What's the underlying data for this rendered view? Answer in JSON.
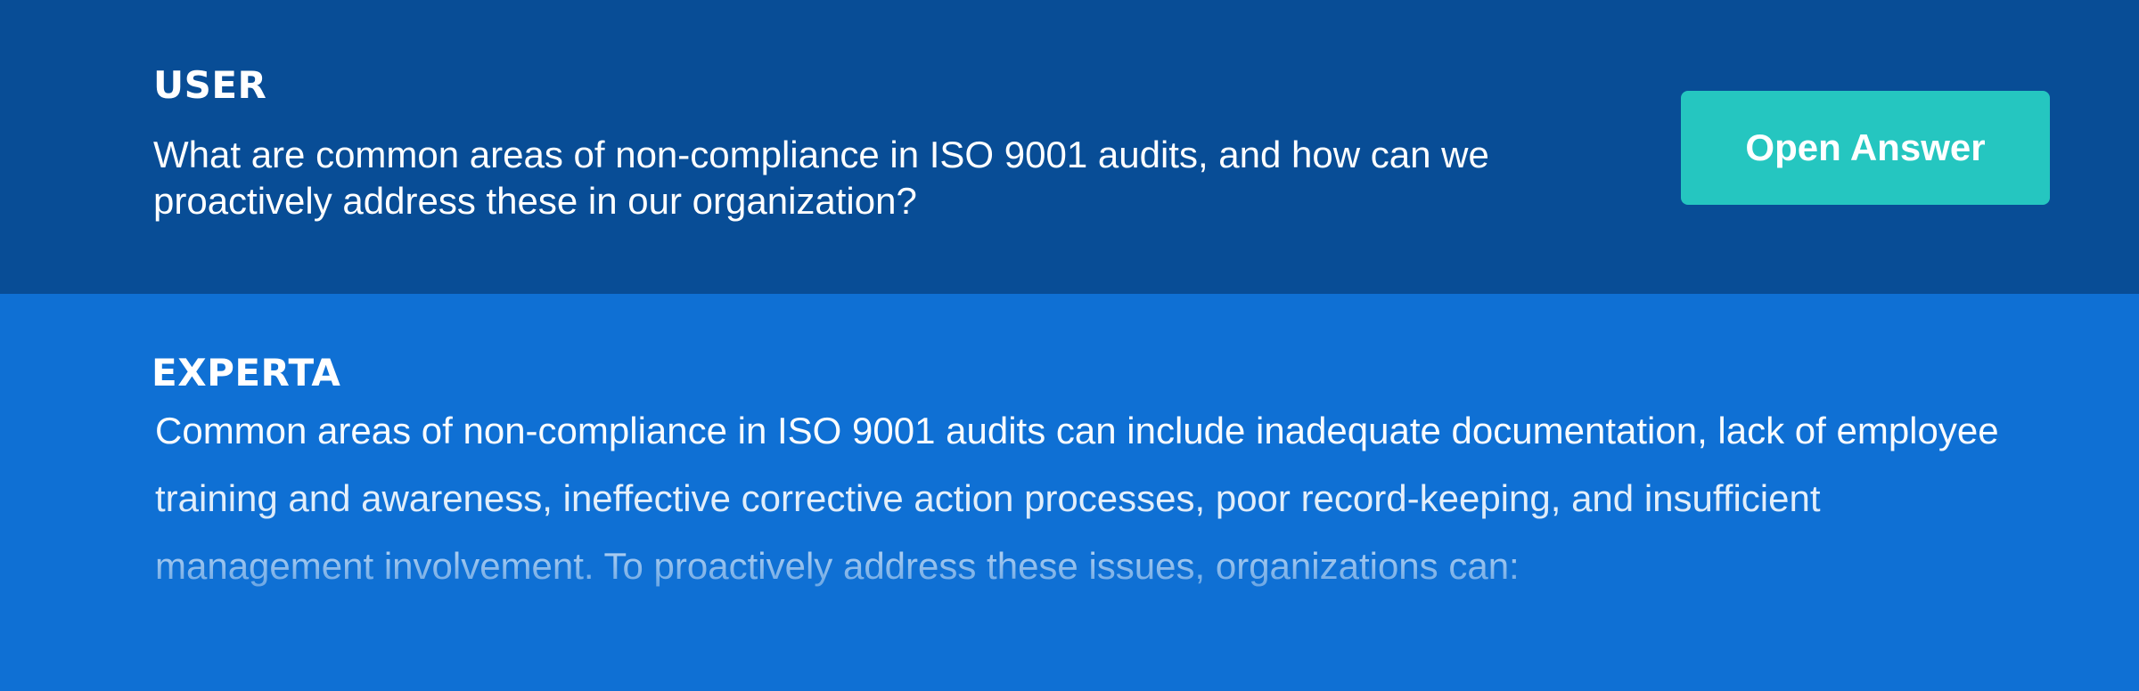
{
  "question": {
    "role_label": "USER",
    "text": "What are common areas of non-compliance in ISO 9001 audits, and how can we proactively address these in our organization?",
    "open_answer_label": "Open Answer"
  },
  "answer": {
    "role_label": "EXPERTA",
    "text": "Common areas of non-compliance in ISO 9001 audits can include inadequate documentation, lack of employee training and awareness, ineffective corrective action processes, poor record-keeping, and insufficient management involvement. To proactively address these issues, organizations can:"
  },
  "colors": {
    "question_bg": "#084d96",
    "answer_bg": "#0f70d4",
    "button_bg": "#25c6c0",
    "text": "#ffffff"
  }
}
